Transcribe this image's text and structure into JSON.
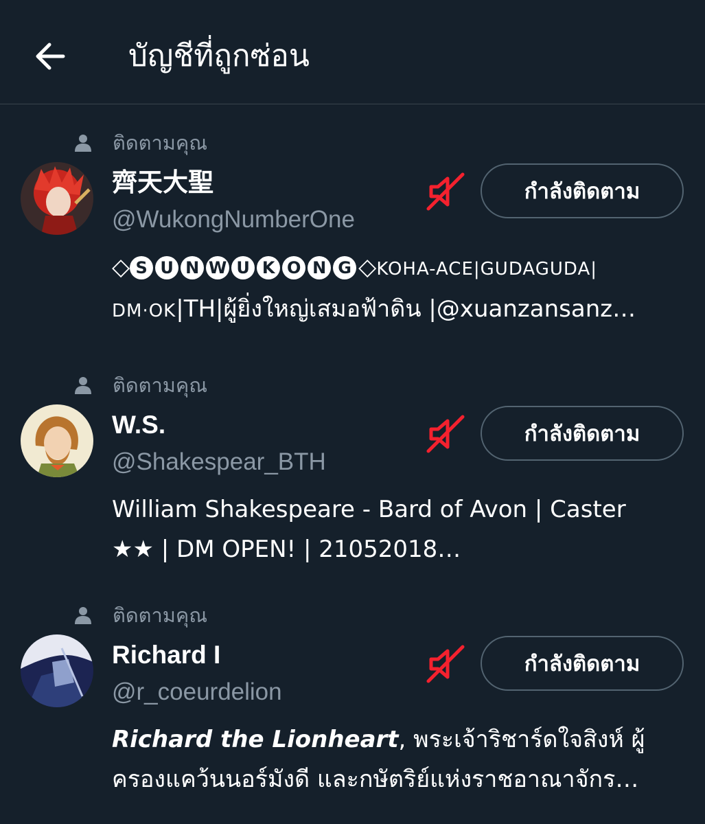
{
  "header": {
    "title": "บัญชีที่ถูกซ่อน",
    "back_icon": "arrow-left-icon"
  },
  "colors": {
    "background": "#15202b",
    "secondary_text": "#8b98a5",
    "mute_icon": "#f4212e",
    "button_border": "#536471"
  },
  "accounts": [
    {
      "follows_you": "ติดตามคุณ",
      "name": "齊天大聖",
      "handle": "@WukongNumberOne",
      "follow_button": "กำลังติดตาม",
      "mute_icon": "speaker-muted-icon",
      "bio": {
        "prefix_symbol": "◇",
        "circled_letters": [
          "S",
          "U",
          "N",
          "W",
          "U",
          "K",
          "O",
          "N",
          "G"
        ],
        "suffix_symbol": "◇",
        "line1_rest": "KOHA-ACE|GUDAGUDA|",
        "line2_smallcaps": "DM·OK",
        "line2_rest": "|TH|ผู้ยิ่งใหญ่เสมอฟ้าดิน |@xuanzansanz…"
      }
    },
    {
      "follows_you": "ติดตามคุณ",
      "name": "W.S.",
      "handle": "@Shakespear_BTH",
      "follow_button": "กำลังติดตาม",
      "mute_icon": "speaker-muted-icon",
      "bio": {
        "line1": "William Shakespeare - Bard of Avon | Caster",
        "line2": "★★ | DM OPEN! | 21052018…"
      }
    },
    {
      "follows_you": "ติดตามคุณ",
      "name": "Richard I",
      "handle": "@r_coeurdelion",
      "follow_button": "กำลังติดตาม",
      "mute_icon": "speaker-muted-icon",
      "bio": {
        "line1_emph": "Richard the Lionheart",
        "line1_rest": ", พระเจ้าริชาร์ดใจสิงห์ ผู้",
        "line2": "ครองแคว้นนอร์มังดี และกษัตริย์แห่งราชอาณาจักร…"
      }
    }
  ]
}
